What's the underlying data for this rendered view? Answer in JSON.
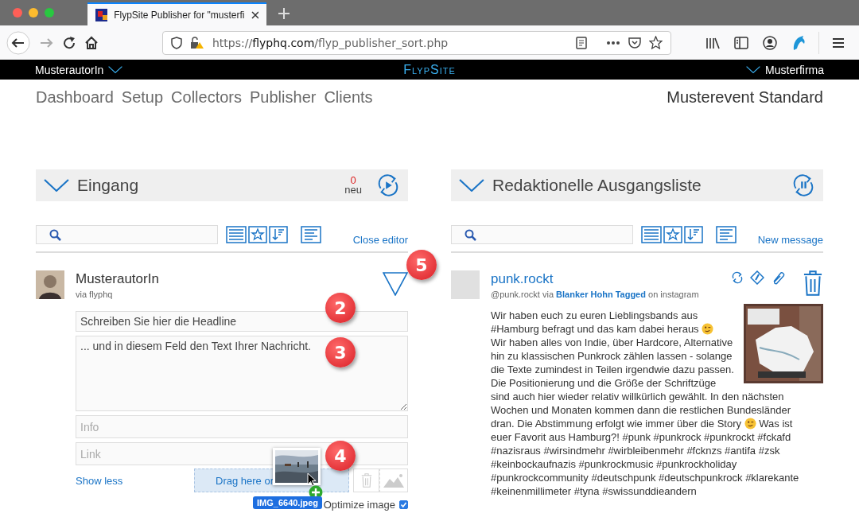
{
  "browser": {
    "tab_title": "FlypSite Publisher for \"musterfi",
    "url_scheme": "https://",
    "url_host": "flyphq.com",
    "url_path": "/flyp_publisher_sort.php"
  },
  "topbar": {
    "user": "MusterautorIn",
    "logo": "FlypSite",
    "company": "Musterfirma"
  },
  "nav": [
    {
      "label": "Dashboard"
    },
    {
      "label": "Setup"
    },
    {
      "label": "Collectors"
    },
    {
      "label": "Publisher"
    },
    {
      "label": "Clients"
    }
  ],
  "event": "Musterevent Standard",
  "panels": [
    {
      "title": "Eingang",
      "new_count": "0",
      "new_label": "neu",
      "paused": false,
      "action_link": "Close editor"
    },
    {
      "title": "Redaktionelle Ausgangsliste",
      "paused": true,
      "action_link": "New message"
    }
  ],
  "editor": {
    "author": "MusterautorIn",
    "source": "via flyphq",
    "headline_placeholder": "Schreiben Sie hier die Headline",
    "text_placeholder": "... und in diesem Feld den Text Ihrer Nachricht.",
    "info_placeholder": "Info",
    "link_placeholder": "Link",
    "show_less": "Show less",
    "dropzone": "Drag here or",
    "optimize_label": "Optimize image",
    "optimize_checked": true
  },
  "message": {
    "author": "punk.rockt",
    "handle": "@punk.rockt via",
    "collector": "Blanker Hohn Tagged",
    "network": "on instagram",
    "body": [
      {
        "kind": "text",
        "text": "Wir haben euch zu euren Lieblingsbands aus #Hamburg befragt und das kam dabei heraus "
      },
      {
        "kind": "emoji"
      },
      {
        "kind": "break"
      },
      {
        "kind": "text",
        "text": "Wir haben alles von Indie, über Hardcore, Alternative hin zu klassischen Punkrock zählen lassen - solange die Texte zumindest in Teilen irgendwie dazu passen. Die Positionierung und die Größe der Schriftzüge sind auch hier wieder relativ willkürlich gewählt. In den nächsten Wochen und Monaten kommen dann die restlichen Bundesländer dran. Die Abstimmung erfolgt wie immer über die Story "
      },
      {
        "kind": "emoji"
      },
      {
        "kind": "text",
        "text": " Was ist euer Favorit aus Hamburg?! #punk #punkrock #punkrockt #fckafd #nazisraus #wirsindmehr #wirbleibenmehr #fcknzs #antifa #zsk #keinbockaufnazis #punkrockmusic #punkrockholiday #punkrockcommunity #deutschpunk #deutschpunkrock #klarekante #keinenmillimeter #tyna #swissunddieandern"
      }
    ]
  },
  "markers": [
    {
      "label": "2"
    },
    {
      "label": "3"
    },
    {
      "label": "4"
    },
    {
      "label": "5"
    }
  ],
  "drag": {
    "filename": "IMG_6640.jpeg"
  }
}
